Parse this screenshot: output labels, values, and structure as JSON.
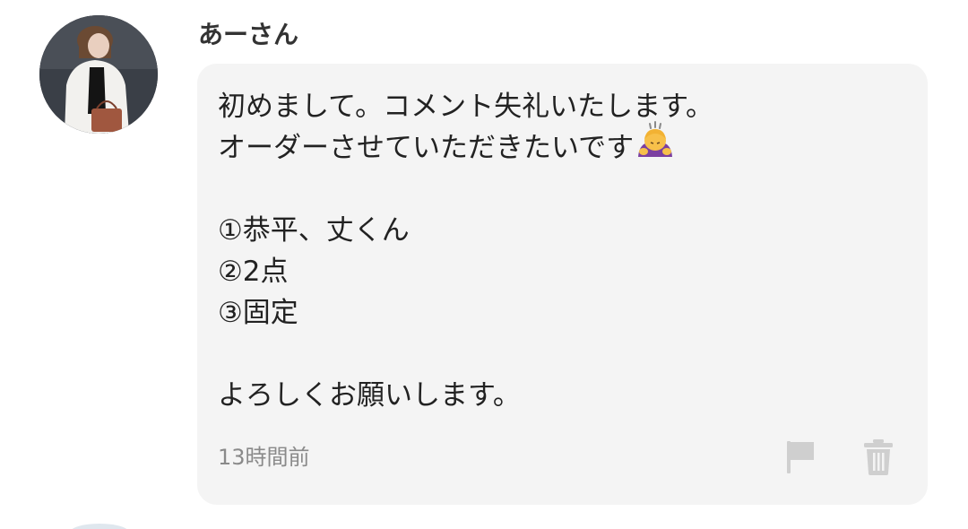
{
  "comment": {
    "username": "あーさん",
    "message_lines": [
      "初めまして。コメント失礼いたします。",
      "オーダーさせていただきたいです",
      "",
      "①恭平、丈くん",
      "②2点",
      "③固定",
      "",
      "よろしくお願いします。"
    ],
    "emoji": "person-bowing-emoji",
    "time": "13時間前",
    "icons": {
      "report": "flag-icon",
      "delete": "trash-icon"
    }
  },
  "colors": {
    "bubble": "#f4f4f4",
    "text": "#222222",
    "meta": "#8a8a8a",
    "icon": "#cfcfcf"
  }
}
